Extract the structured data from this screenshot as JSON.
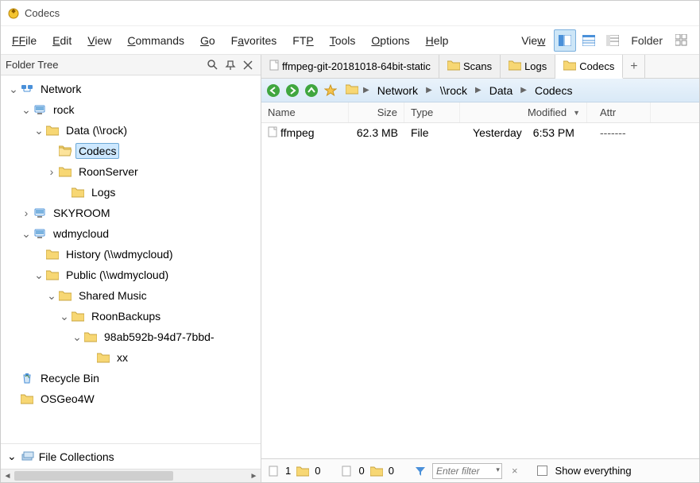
{
  "window": {
    "title": "Codecs"
  },
  "menu": {
    "file": "File",
    "edit": "Edit",
    "view": "View",
    "commands": "Commands",
    "go": "Go",
    "favorites": "Favorites",
    "ftp": "FTP",
    "tools": "Tools",
    "options": "Options",
    "help": "Help",
    "view_right": "View",
    "folder": "Folder"
  },
  "sidebar": {
    "title": "Folder Tree",
    "fc_label": "File Collections",
    "nodes": {
      "network": "Network",
      "rock": "rock",
      "data": "Data (\\\\rock)",
      "codecs": "Codecs",
      "roonserver": "RoonServer",
      "logs": "Logs",
      "skyroom": "SKYROOM",
      "wdmycloud": "wdmycloud",
      "history": "History (\\\\wdmycloud)",
      "public": "Public (\\\\wdmycloud)",
      "sharedmusic": "Shared Music",
      "roonbackups": "RoonBackups",
      "guid": "98ab592b-94d7-7bbd-",
      "xx": "xx",
      "recycle": "Recycle Bin",
      "osgeo4w": "OSGeo4W"
    }
  },
  "tabs": {
    "t0": "ffmpeg-git-20181018-64bit-static",
    "t1": "Scans",
    "t2": "Logs",
    "t3": "Codecs"
  },
  "breadcrumb": {
    "b1": "Network",
    "b2": "\\\\rock",
    "b3": "Data",
    "b4": "Codecs"
  },
  "columns": {
    "name": "Name",
    "size": "Size",
    "type": "Type",
    "modified": "Modified",
    "attr": "Attr"
  },
  "files": [
    {
      "name": "ffmpeg",
      "size": "62.3 MB",
      "type": "File",
      "modified_day": "Yesterday",
      "modified_time": "6:53 PM",
      "attr": "-------"
    }
  ],
  "status": {
    "count1": "1",
    "count2": "0",
    "count3": "0",
    "count4": "0",
    "filter_placeholder": "Enter filter",
    "show_everything": "Show everything"
  }
}
